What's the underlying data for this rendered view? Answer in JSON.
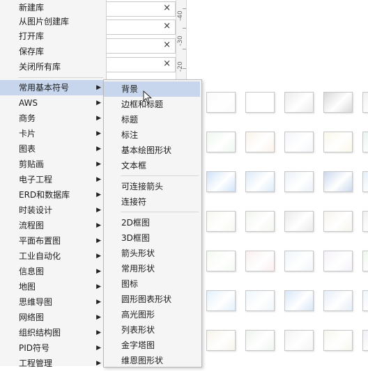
{
  "top_menu": [
    {
      "label": "新建库"
    },
    {
      "label": "从图片创建库"
    },
    {
      "label": "打开库"
    },
    {
      "label": "保存库"
    },
    {
      "label": "关闭所有库"
    }
  ],
  "category_menu": [
    {
      "label": "常用基本符号",
      "arrow": "▶",
      "active": true
    },
    {
      "label": "AWS",
      "arrow": "▶"
    },
    {
      "label": "商务",
      "arrow": "▶"
    },
    {
      "label": "卡片",
      "arrow": "▶"
    },
    {
      "label": "图表",
      "arrow": "▶"
    },
    {
      "label": "剪贴画",
      "arrow": "▶"
    },
    {
      "label": "电子工程",
      "arrow": "▶"
    },
    {
      "label": "ERD和数据库",
      "arrow": "▶"
    },
    {
      "label": "时装设计",
      "arrow": "▶"
    },
    {
      "label": "流程图",
      "arrow": "▶"
    },
    {
      "label": "平面布置图",
      "arrow": "▶"
    },
    {
      "label": "工业自动化",
      "arrow": "▶"
    },
    {
      "label": "信息图",
      "arrow": "▶"
    },
    {
      "label": "地图",
      "arrow": "▶"
    },
    {
      "label": "思维导图",
      "arrow": "▶"
    },
    {
      "label": "网络图",
      "arrow": "▶"
    },
    {
      "label": "组织结构图",
      "arrow": "▶"
    },
    {
      "label": "PID符号",
      "arrow": "▶"
    },
    {
      "label": "工程管理",
      "arrow": "▶"
    }
  ],
  "submenu": {
    "group1": [
      {
        "label": "背景",
        "active": true
      },
      {
        "label": "边框和标题"
      },
      {
        "label": "标题"
      },
      {
        "label": "标注"
      },
      {
        "label": "基本绘图形状"
      },
      {
        "label": "文本框"
      }
    ],
    "group2": [
      {
        "label": "可连接箭头"
      },
      {
        "label": "连接符"
      }
    ],
    "group3": [
      {
        "label": "2D框图"
      },
      {
        "label": "3D框图"
      },
      {
        "label": "箭头形状"
      },
      {
        "label": "常用形状"
      },
      {
        "label": "图标"
      },
      {
        "label": "圆形图表形状"
      },
      {
        "label": "高光图形"
      },
      {
        "label": "列表形状"
      },
      {
        "label": "金字塔图"
      },
      {
        "label": "维恩图形状"
      }
    ]
  },
  "search_fields": [
    {
      "clear_icon": "×"
    },
    {
      "clear_icon": "×"
    },
    {
      "clear_icon": "×"
    },
    {
      "clear_icon": "×"
    }
  ],
  "ruler_marks": [
    "-40",
    "-30",
    "-20"
  ],
  "colors": {
    "menu_bg": "#f5f5f5",
    "highlight": "#c7d6ec"
  }
}
